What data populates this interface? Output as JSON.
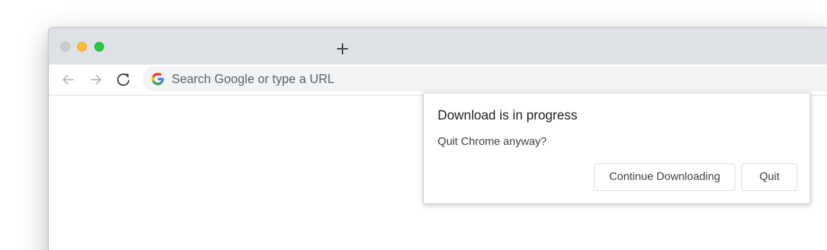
{
  "window": {
    "controls": [
      "close",
      "minimize",
      "maximize"
    ],
    "new_tab_icon": "plus-icon"
  },
  "toolbar": {
    "back_icon": "arrow-left-icon",
    "forward_icon": "arrow-right-icon",
    "reload_icon": "reload-icon",
    "omnibox": {
      "icon": "google-g-icon",
      "placeholder": "Search Google or type a URL"
    }
  },
  "dialog": {
    "title": "Download is in progress",
    "message": "Quit Chrome anyway?",
    "continue_label": "Continue Downloading",
    "quit_label": "Quit"
  },
  "colors": {
    "titlebar": "#dee1e6",
    "omnibox_bg": "#f1f3f4",
    "traffic_close": "#cdcdcd",
    "traffic_minimize": "#febc2e",
    "traffic_maximize": "#28c840"
  }
}
